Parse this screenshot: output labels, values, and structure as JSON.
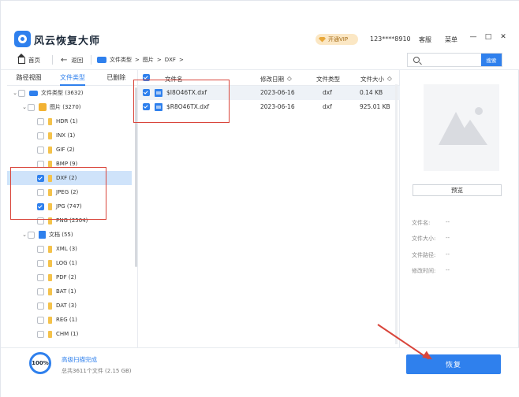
{
  "app": {
    "title": "风云恢复大师",
    "vip_label": "开通VIP",
    "account": "123****8910",
    "links": [
      "客服",
      "菜单"
    ],
    "window_controls": [
      "—",
      "□",
      "✕"
    ]
  },
  "nav": {
    "home": "首页",
    "back": "返回",
    "breadcrumb": [
      "文件类型",
      "图片",
      "DXF"
    ],
    "search_placeholder": "",
    "search_button": "搜索"
  },
  "left": {
    "tabs": [
      "路径视图",
      "文件类型",
      "已删除"
    ],
    "active_tab": 1,
    "tree": [
      {
        "label": "文件类型 (3632)",
        "level": 0,
        "icon": "disk-icon",
        "expanded": true,
        "checked": false
      },
      {
        "label": "图片 (3270)",
        "level": 1,
        "icon": "picture-icon",
        "expanded": true,
        "checked": false
      },
      {
        "label": "HDR (1)",
        "level": 2,
        "icon": "folder-icon",
        "checked": false
      },
      {
        "label": "INX (1)",
        "level": 2,
        "icon": "folder-icon",
        "checked": false
      },
      {
        "label": "GIF (2)",
        "level": 2,
        "icon": "folder-icon",
        "checked": false
      },
      {
        "label": "BMP (9)",
        "level": 2,
        "icon": "folder-icon",
        "checked": false
      },
      {
        "label": "DXF (2)",
        "level": 2,
        "icon": "folder-icon",
        "checked": true,
        "selected": true
      },
      {
        "label": "JPEG (2)",
        "level": 2,
        "icon": "folder-icon",
        "checked": false
      },
      {
        "label": "JPG (747)",
        "level": 2,
        "icon": "folder-icon",
        "checked": true
      },
      {
        "label": "PNG (2504)",
        "level": 2,
        "icon": "folder-icon",
        "checked": false
      },
      {
        "label": "文档 (55)",
        "level": 1,
        "icon": "document-icon",
        "expanded": true,
        "checked": false
      },
      {
        "label": "XML (3)",
        "level": 2,
        "icon": "folder-icon",
        "checked": false
      },
      {
        "label": "LOG (1)",
        "level": 2,
        "icon": "folder-icon",
        "checked": false
      },
      {
        "label": "PDF (2)",
        "level": 2,
        "icon": "folder-icon",
        "checked": false
      },
      {
        "label": "BAT (1)",
        "level": 2,
        "icon": "folder-icon",
        "checked": false
      },
      {
        "label": "DAT (3)",
        "level": 2,
        "icon": "folder-icon",
        "checked": false
      },
      {
        "label": "REG (1)",
        "level": 2,
        "icon": "folder-icon",
        "checked": false
      },
      {
        "label": "CHM (1)",
        "level": 2,
        "icon": "folder-icon",
        "checked": false
      }
    ]
  },
  "list": {
    "columns": [
      "文件名",
      "修改日期",
      "文件类型",
      "文件大小"
    ],
    "sort_marker": "◇",
    "rows": [
      {
        "name": "$I8O46TX.dxf",
        "date": "2023-06-16",
        "type": "dxf",
        "size": "0.14 KB",
        "checked": true
      },
      {
        "name": "$R8O46TX.dxf",
        "date": "2023-06-16",
        "type": "dxf",
        "size": "925.01 KB",
        "checked": true
      }
    ]
  },
  "preview": {
    "button": "预览",
    "meta": [
      {
        "label": "文件名:",
        "value": "--"
      },
      {
        "label": "文件大小:",
        "value": "--"
      },
      {
        "label": "文件路径:",
        "value": "--"
      },
      {
        "label": "修改时间:",
        "value": "--"
      }
    ]
  },
  "status": {
    "progress_text": "100%",
    "progress": 1.0,
    "title": "高级扫描完成",
    "summary": "总共3611个文件 (2.15 GB)",
    "recover_button": "恢复"
  },
  "colors": {
    "accent": "#2f80ed",
    "annotation": "#d9453b",
    "folder": "#f4c24b"
  }
}
